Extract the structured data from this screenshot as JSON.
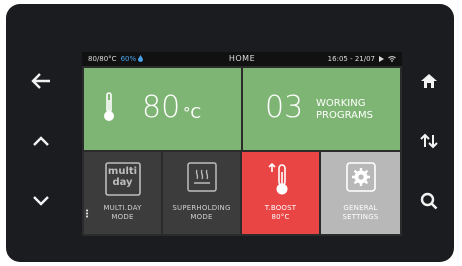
{
  "status": {
    "temp": "80/80°C",
    "humidity": "60%",
    "title": "HOME",
    "datetime": "16:05 - 21/07"
  },
  "tiles": {
    "temperature": {
      "value": "80",
      "unit": "°C"
    },
    "programs": {
      "count": "03",
      "line1": "WORKING",
      "line2": "PROGRAMS"
    },
    "multiday": {
      "icon_text_1": "multi",
      "icon_text_2": "day",
      "line1": "MULTI.DAY",
      "line2": "MODE"
    },
    "superholding": {
      "line1": "SUPERHOLDING",
      "line2": "MODE"
    },
    "tboost": {
      "line1": "T.BOOST",
      "line2": "80°C"
    },
    "general": {
      "line1": "GENERAL",
      "line2": "SETTINGS"
    }
  },
  "colors": {
    "green": "#7fb574",
    "red": "#e94545",
    "grey": "#b8b8b8",
    "dark_tile": "#3c3c3c",
    "humidity": "#4aa3e8"
  },
  "icons": {
    "left": [
      "back-arrow-icon",
      "up-chevron-icon",
      "down-chevron-icon"
    ],
    "right": [
      "home-icon",
      "sort-arrows-icon",
      "search-icon"
    ]
  }
}
